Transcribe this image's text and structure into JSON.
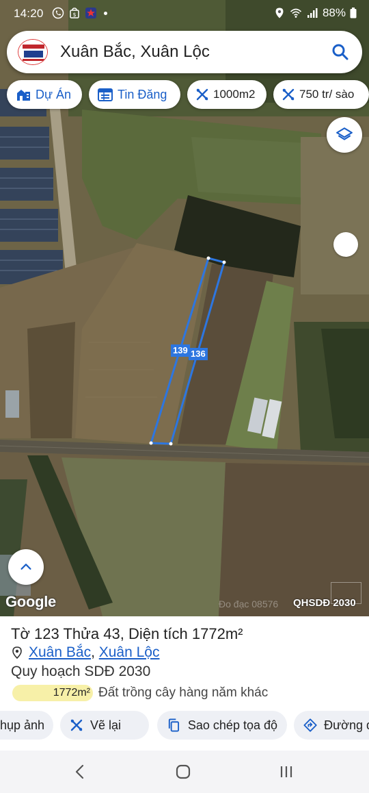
{
  "status": {
    "time": "14:20",
    "battery": "88%"
  },
  "search": {
    "query": "Xuân Bắc, Xuân Lộc"
  },
  "chips": {
    "du_an": "Dự Án",
    "tin_dang": "Tin Đăng",
    "area": "1000m2",
    "price": "750 tr/ sào"
  },
  "map": {
    "edge_left": "139",
    "edge_right": "136",
    "google": "Google",
    "watermark": "Đo đạc 08576",
    "plan_label": "QHSDĐ 2030"
  },
  "parcel": {
    "to_label": "Tờ",
    "to_value": "123",
    "thua_label": "Thửa",
    "thua_value": "43",
    "area_label": "Diện tích",
    "area_value": "1772m²",
    "ward": "Xuân Bắc",
    "district": "Xuân Lộc",
    "plan_title": "Quy hoạch SDĐ 2030",
    "land_area": "1772m²",
    "land_type": "Đất trồng cây hàng năm khác"
  },
  "actions": {
    "chup_anh": "hụp ảnh",
    "ve_lai": "Vẽ lại",
    "sao_chep": "Sao chép tọa độ",
    "duong_di": "Đường đ"
  },
  "colors": {
    "accent": "#1a5fc8",
    "parcel_line": "#2d76e0",
    "area_pill": "#f7f0a8"
  }
}
